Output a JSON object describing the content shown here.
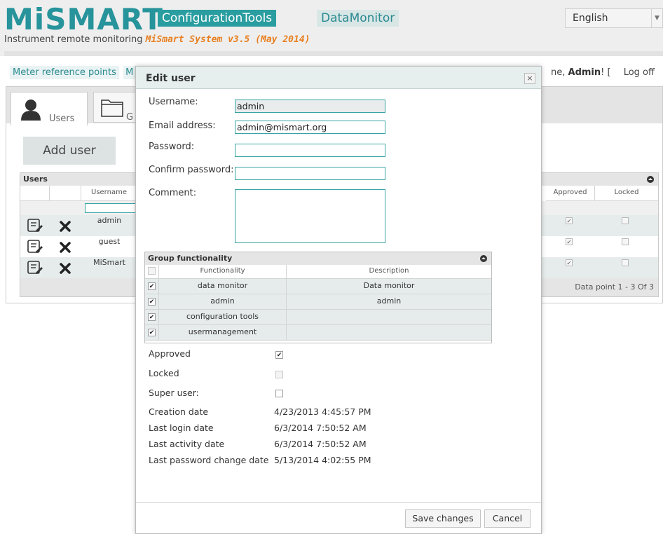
{
  "header": {
    "logo_text": "MiSMART",
    "nav": {
      "active": "ConfigurationTools",
      "inactive": "DataMonitor"
    },
    "subtitle": "Instrument remote monitoring",
    "version": "MiSmart System v3.5 (May 2014)",
    "language": "English"
  },
  "menu": {
    "item1": "Meter reference points",
    "item2_fragment": "M",
    "welcome_prefix": "ne, ",
    "welcome_user": "Admin",
    "welcome_suffix": "! [",
    "logoff": "Log off"
  },
  "page": {
    "tabs": {
      "users": "Users",
      "groups_fragment": "G"
    },
    "add_user_label": "Add user",
    "grid": {
      "title": "Users",
      "col_username": "Username",
      "col_approved": "Approved",
      "col_locked": "Locked",
      "rows": [
        {
          "username": "admin"
        },
        {
          "username": "guest"
        },
        {
          "username": "MiSmart"
        }
      ],
      "footer": "Data point 1 - 3 Of 3"
    }
  },
  "modal": {
    "title": "Edit user",
    "close_glyph": "×",
    "fields": {
      "username_label": "Username:",
      "username_value": "admin",
      "email_label": "Email address:",
      "email_value": "admin@mismart.org",
      "password_label": "Password:",
      "confirm_label": "Confirm password:",
      "comment_label": "Comment:"
    },
    "group_functionality": {
      "title": "Group functionality",
      "col_functionality": "Functionality",
      "col_description": "Description",
      "rows": [
        {
          "functionality": "data monitor",
          "description": "Data monitor",
          "checked": true
        },
        {
          "functionality": "admin",
          "description": "admin",
          "checked": true
        },
        {
          "functionality": "configuration tools",
          "description": "",
          "checked": true
        },
        {
          "functionality": "usermanagement",
          "description": "",
          "checked": true
        }
      ]
    },
    "flags": {
      "approved_label": "Approved",
      "approved": true,
      "locked_label": "Locked",
      "locked": false,
      "superuser_label": "Super user:",
      "superuser": false
    },
    "info": {
      "creation_label": "Creation date",
      "creation_value": "4/23/2013 4:45:57 PM",
      "last_login_label": "Last login date",
      "last_login_value": "6/3/2014 7:50:52 AM",
      "last_activity_label": "Last activity date",
      "last_activity_value": "6/3/2014 7:50:52 AM",
      "last_pwd_label": "Last password change date",
      "last_pwd_value": "5/13/2014 4:02:55 PM"
    },
    "buttons": {
      "save": "Save changes",
      "cancel": "Cancel"
    }
  },
  "colors": {
    "brand_teal": "#27939b",
    "version_orange": "#e87f1f",
    "input_border": "#38a3a3"
  }
}
